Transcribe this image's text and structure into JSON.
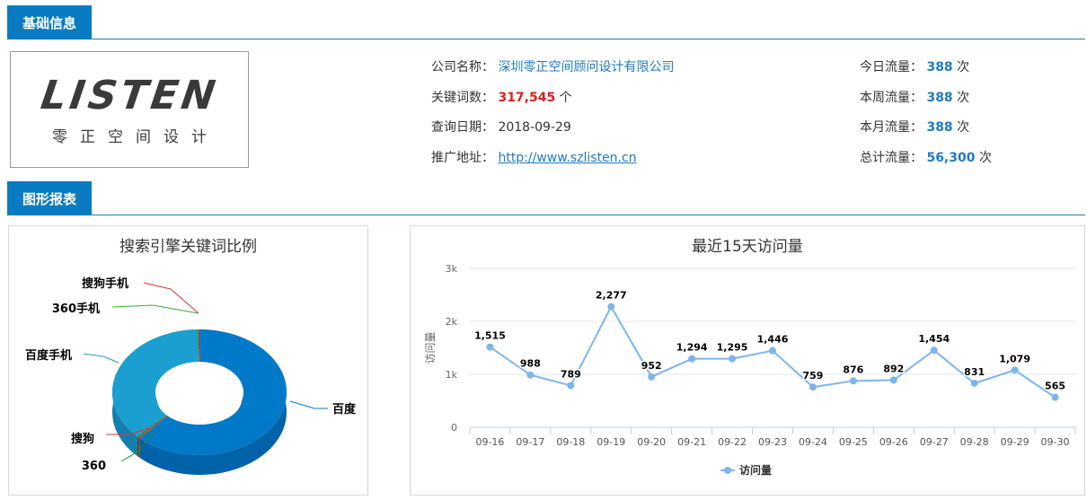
{
  "sections": {
    "basic_info": "基础信息",
    "charts": "图形报表"
  },
  "logo": {
    "word": "LISTEN",
    "sub": "零正空间设计"
  },
  "info": {
    "company_label": "公司名称：",
    "company_value": "深圳零正空间顾问设计有限公司",
    "keywords_label": "关键词数：",
    "keywords_value": "317,545",
    "keywords_unit": "个",
    "date_label": "查询日期：",
    "date_value": "2018-09-29",
    "url_label": "推广地址：",
    "url_value": "http://www.szlisten.cn",
    "today_label": "今日流量：",
    "today_value": "388",
    "today_unit": "次",
    "week_label": "本周流量：",
    "week_value": "388",
    "week_unit": "次",
    "month_label": "本月流量：",
    "month_value": "388",
    "month_unit": "次",
    "total_label": "总计流量：",
    "total_value": "56,300",
    "total_unit": "次"
  },
  "colors": {
    "accent": "#0a7bc2",
    "link": "#1f7ac4",
    "red": "#e21d1d",
    "line": "#7cb5ec"
  },
  "chart_data": [
    {
      "type": "pie",
      "title": "搜索引擎关键词比例",
      "labels": [
        "百度",
        "搜狗",
        "360",
        "百度手机",
        "360手机",
        "搜狗手机"
      ],
      "values": [
        62,
        0.3,
        0.3,
        37,
        0.2,
        0.2
      ]
    },
    {
      "type": "line",
      "title": "最近15天访问量",
      "ylabel": "访问量",
      "categories": [
        "09-16",
        "09-17",
        "09-18",
        "09-19",
        "09-20",
        "09-21",
        "09-22",
        "09-23",
        "09-24",
        "09-25",
        "09-26",
        "09-27",
        "09-28",
        "09-29",
        "09-30"
      ],
      "series": [
        {
          "name": "访问量",
          "values": [
            1515,
            988,
            789,
            2277,
            952,
            1294,
            1295,
            1446,
            759,
            876,
            892,
            1454,
            831,
            1079,
            565
          ]
        }
      ],
      "data_labels": [
        "1,515",
        "988",
        "789",
        "2,277",
        "952",
        "1,294",
        "1,295",
        "1,446",
        "759",
        "876",
        "892",
        "1,454",
        "831",
        "1,079",
        "565"
      ],
      "yticks": [
        "0",
        "1k",
        "2k",
        "3k"
      ],
      "ylim": [
        0,
        3000
      ],
      "grid": true,
      "legend": "bottom-center"
    }
  ]
}
